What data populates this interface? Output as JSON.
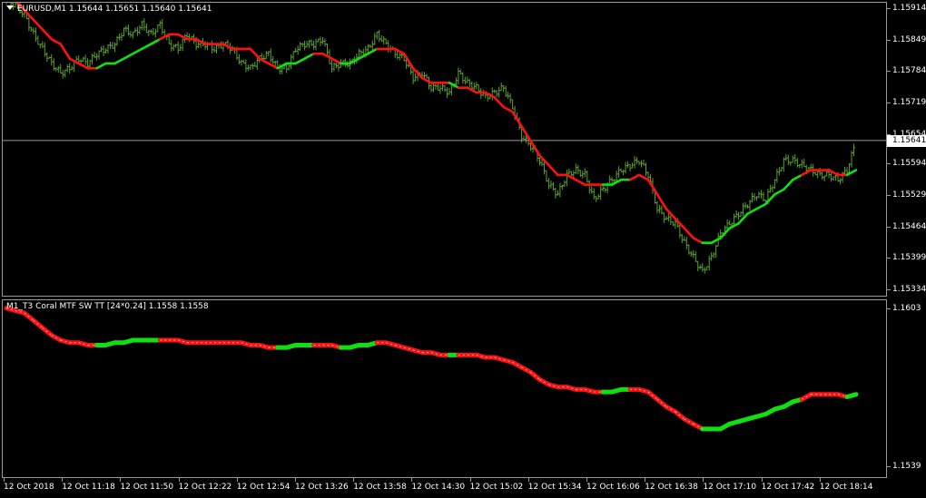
{
  "main_pane": {
    "label": "EURUSD,M1  1.15644 1.15651 1.15640 1.15641",
    "y_ticks": [
      "1.15914",
      "1.15849",
      "1.15784",
      "1.15719",
      "1.15654",
      "1.15594",
      "1.15529",
      "1.15464",
      "1.15399",
      "1.15334"
    ],
    "current_price": "1.15641"
  },
  "indicator_pane": {
    "label": "M1_T3 Coral MTF SW TT [24*0.24] 1.1558 1.1558",
    "y_ticks": [
      "1.1603",
      "1.1539"
    ]
  },
  "x_ticks": [
    "12 Oct 2018",
    "12 Oct 11:18",
    "12 Oct 11:50",
    "12 Oct 12:22",
    "12 Oct 12:54",
    "12 Oct 13:26",
    "12 Oct 13:58",
    "12 Oct 14:30",
    "12 Oct 15:02",
    "12 Oct 15:34",
    "12 Oct 16:06",
    "12 Oct 16:38",
    "12 Oct 17:10",
    "12 Oct 17:42",
    "12 Oct 18:14"
  ],
  "colors": {
    "background": "#000000",
    "bars": "#5aa02c",
    "coral_down": "#ff1010",
    "coral_up": "#10e010",
    "price_line": "#9a9a9a",
    "text": "#ffffff"
  },
  "chart_data": [
    {
      "type": "line",
      "title": "EURUSD,M1",
      "ylim": [
        1.15334,
        1.15914
      ],
      "series": [
        {
          "name": "T3 Coral",
          "x": [
            0,
            10,
            20,
            30,
            40,
            50,
            60,
            70,
            80,
            90,
            100,
            110,
            120,
            130,
            140,
            150,
            160,
            170,
            180,
            190,
            200,
            210,
            220,
            230,
            240,
            250,
            260,
            270,
            280,
            290,
            300,
            310,
            320,
            330,
            340,
            350,
            360,
            370,
            380,
            390,
            400,
            410,
            420,
            430,
            440,
            450,
            460,
            470,
            480,
            490,
            500,
            510,
            520,
            530,
            540,
            550,
            560,
            570,
            580,
            590,
            600,
            610,
            620,
            630,
            640,
            650,
            660,
            670,
            680,
            690,
            700,
            710,
            720,
            730,
            740,
            750,
            760,
            770,
            780,
            790,
            800,
            810,
            820,
            830,
            840,
            850,
            860,
            870,
            880,
            890,
            900,
            910,
            920,
            930,
            940
          ],
          "values": [
            1.1595,
            1.1593,
            1.1591,
            1.1589,
            1.1587,
            1.1585,
            1.1584,
            1.1581,
            1.158,
            1.1579,
            1.1579,
            1.158,
            1.158,
            1.1581,
            1.1582,
            1.1583,
            1.1584,
            1.1585,
            1.1586,
            1.1586,
            1.1585,
            1.1585,
            1.1584,
            1.1584,
            1.1584,
            1.1583,
            1.1583,
            1.1583,
            1.1581,
            1.158,
            1.1579,
            1.158,
            1.158,
            1.1581,
            1.1582,
            1.1582,
            1.1581,
            1.158,
            1.158,
            1.1581,
            1.1582,
            1.1583,
            1.1583,
            1.1583,
            1.1582,
            1.1579,
            1.1577,
            1.1576,
            1.1576,
            1.1576,
            1.1575,
            1.1575,
            1.1574,
            1.1574,
            1.1573,
            1.1571,
            1.157,
            1.1567,
            1.1564,
            1.1561,
            1.1559,
            1.1557,
            1.1557,
            1.1556,
            1.1555,
            1.1555,
            1.1555,
            1.1555,
            1.1556,
            1.1556,
            1.1557,
            1.1556,
            1.1553,
            1.155,
            1.1548,
            1.1546,
            1.1544,
            1.1543,
            1.1543,
            1.1544,
            1.1546,
            1.1547,
            1.1549,
            1.155,
            1.1551,
            1.1553,
            1.1554,
            1.1556,
            1.1557,
            1.1558,
            1.1558,
            1.1558,
            1.1557,
            1.1557,
            1.1558
          ],
          "trend": [
            "down",
            "down",
            "down",
            "down",
            "down",
            "down",
            "down",
            "down",
            "down",
            "down",
            "down",
            "up",
            "up",
            "up",
            "up",
            "up",
            "up",
            "up",
            "down",
            "down",
            "down",
            "down",
            "down",
            "down",
            "down",
            "down",
            "down",
            "down",
            "down",
            "down",
            "down",
            "up",
            "up",
            "up",
            "up",
            "down",
            "down",
            "down",
            "up",
            "up",
            "up",
            "up",
            "down",
            "down",
            "down",
            "down",
            "down",
            "down",
            "down",
            "down",
            "up",
            "down",
            "down",
            "down",
            "down",
            "down",
            "down",
            "down",
            "down",
            "down",
            "down",
            "down",
            "down",
            "down",
            "down",
            "down",
            "down",
            "up",
            "up",
            "up",
            "down",
            "down",
            "down",
            "down",
            "down",
            "down",
            "down",
            "down",
            "up",
            "up",
            "up",
            "up",
            "up",
            "up",
            "up",
            "up",
            "up",
            "up",
            "up",
            "down",
            "down",
            "down",
            "down",
            "down",
            "up"
          ]
        },
        {
          "name": "EURUSD close",
          "x": [
            0,
            10,
            20,
            30,
            40,
            50,
            60,
            70,
            80,
            90,
            100,
            110,
            120,
            130,
            140,
            150,
            160,
            170,
            180,
            190,
            200,
            210,
            220,
            230,
            240,
            250,
            260,
            270,
            280,
            290,
            300,
            310,
            320,
            330,
            340,
            350,
            360,
            370,
            380,
            390,
            400,
            410,
            420,
            430,
            440,
            450,
            460,
            470,
            480,
            490,
            500,
            510,
            520,
            530,
            540,
            550,
            560,
            570,
            580,
            590,
            600,
            610,
            620,
            630,
            640,
            650,
            660,
            670,
            680,
            690,
            700,
            710,
            720,
            730,
            740,
            750,
            760,
            770,
            780,
            790,
            800,
            810,
            820,
            830,
            840,
            850,
            860,
            870,
            880,
            890,
            900,
            910,
            920,
            930,
            940
          ],
          "values": [
            1.1593,
            1.1592,
            1.159,
            1.1586,
            1.1583,
            1.158,
            1.1578,
            1.1579,
            1.1581,
            1.158,
            1.1582,
            1.1583,
            1.1584,
            1.1587,
            1.1586,
            1.1588,
            1.1586,
            1.1588,
            1.1584,
            1.1583,
            1.1586,
            1.1584,
            1.1584,
            1.1583,
            1.1584,
            1.1583,
            1.158,
            1.1579,
            1.1581,
            1.1582,
            1.1579,
            1.1579,
            1.1583,
            1.1584,
            1.1584,
            1.1585,
            1.1579,
            1.158,
            1.158,
            1.1582,
            1.1583,
            1.1586,
            1.1584,
            1.1582,
            1.1581,
            1.1577,
            1.1578,
            1.1575,
            1.1575,
            1.1574,
            1.1578,
            1.1576,
            1.1575,
            1.1573,
            1.1574,
            1.1575,
            1.1571,
            1.1565,
            1.1563,
            1.156,
            1.1555,
            1.1553,
            1.1557,
            1.1558,
            1.1557,
            1.1552,
            1.1554,
            1.1556,
            1.1558,
            1.1559,
            1.156,
            1.1557,
            1.155,
            1.1548,
            1.1547,
            1.1543,
            1.154,
            1.1537,
            1.154,
            1.1545,
            1.1547,
            1.1549,
            1.1551,
            1.1553,
            1.1552,
            1.1556,
            1.156,
            1.156,
            1.1559,
            1.1558,
            1.1557,
            1.1557,
            1.1556,
            1.1558,
            1.1564
          ]
        }
      ]
    },
    {
      "type": "line",
      "title": "M1_T3 Coral MTF SW TT [24*0.24]",
      "ylim": [
        1.1537,
        1.1604
      ],
      "series": [
        {
          "name": "T3 Coral",
          "x": [
            0,
            10,
            20,
            30,
            40,
            50,
            60,
            70,
            80,
            90,
            100,
            110,
            120,
            130,
            140,
            150,
            160,
            170,
            180,
            190,
            200,
            210,
            220,
            230,
            240,
            250,
            260,
            270,
            280,
            290,
            300,
            310,
            320,
            330,
            340,
            350,
            360,
            370,
            380,
            390,
            400,
            410,
            420,
            430,
            440,
            450,
            460,
            470,
            480,
            490,
            500,
            510,
            520,
            530,
            540,
            550,
            560,
            570,
            580,
            590,
            600,
            610,
            620,
            630,
            640,
            650,
            660,
            670,
            680,
            690,
            700,
            710,
            720,
            730,
            740,
            750,
            760,
            770,
            780,
            790,
            800,
            810,
            820,
            830,
            840,
            850,
            860,
            870,
            880,
            890,
            900,
            910,
            920,
            930,
            940
          ],
          "values": [
            1.1603,
            1.1602,
            1.1601,
            1.1598,
            1.1595,
            1.1592,
            1.159,
            1.1589,
            1.1589,
            1.1588,
            1.1588,
            1.1588,
            1.1589,
            1.1589,
            1.159,
            1.159,
            1.159,
            1.159,
            1.159,
            1.159,
            1.1589,
            1.1589,
            1.1589,
            1.1589,
            1.1589,
            1.1589,
            1.1589,
            1.1588,
            1.1588,
            1.1587,
            1.1587,
            1.1587,
            1.1588,
            1.1588,
            1.1588,
            1.1588,
            1.1588,
            1.1587,
            1.1587,
            1.1588,
            1.1588,
            1.1589,
            1.1589,
            1.1588,
            1.1587,
            1.1586,
            1.1585,
            1.1585,
            1.1584,
            1.1584,
            1.1584,
            1.1584,
            1.1584,
            1.1583,
            1.1583,
            1.1582,
            1.1581,
            1.1579,
            1.1577,
            1.1574,
            1.1572,
            1.1571,
            1.1571,
            1.157,
            1.157,
            1.1569,
            1.1569,
            1.1569,
            1.157,
            1.157,
            1.157,
            1.1569,
            1.1566,
            1.1563,
            1.1561,
            1.1558,
            1.1556,
            1.1554,
            1.1554,
            1.1554,
            1.1556,
            1.1557,
            1.1558,
            1.1559,
            1.156,
            1.1562,
            1.1563,
            1.1565,
            1.1566,
            1.1568,
            1.1568,
            1.1568,
            1.1568,
            1.1567,
            1.1568
          ],
          "trend": [
            "down",
            "down",
            "down",
            "down",
            "down",
            "down",
            "down",
            "down",
            "down",
            "down",
            "down",
            "up",
            "up",
            "up",
            "up",
            "up",
            "up",
            "up",
            "down",
            "down",
            "down",
            "down",
            "down",
            "down",
            "down",
            "down",
            "down",
            "down",
            "down",
            "down",
            "down",
            "up",
            "up",
            "up",
            "up",
            "down",
            "down",
            "down",
            "up",
            "up",
            "up",
            "up",
            "down",
            "down",
            "down",
            "down",
            "down",
            "down",
            "down",
            "down",
            "up",
            "down",
            "down",
            "down",
            "down",
            "down",
            "down",
            "down",
            "down",
            "down",
            "down",
            "down",
            "down",
            "down",
            "down",
            "down",
            "down",
            "up",
            "up",
            "up",
            "down",
            "down",
            "down",
            "down",
            "down",
            "down",
            "down",
            "down",
            "up",
            "up",
            "up",
            "up",
            "up",
            "up",
            "up",
            "up",
            "up",
            "up",
            "up",
            "down",
            "down",
            "down",
            "down",
            "down",
            "up"
          ]
        }
      ]
    }
  ]
}
